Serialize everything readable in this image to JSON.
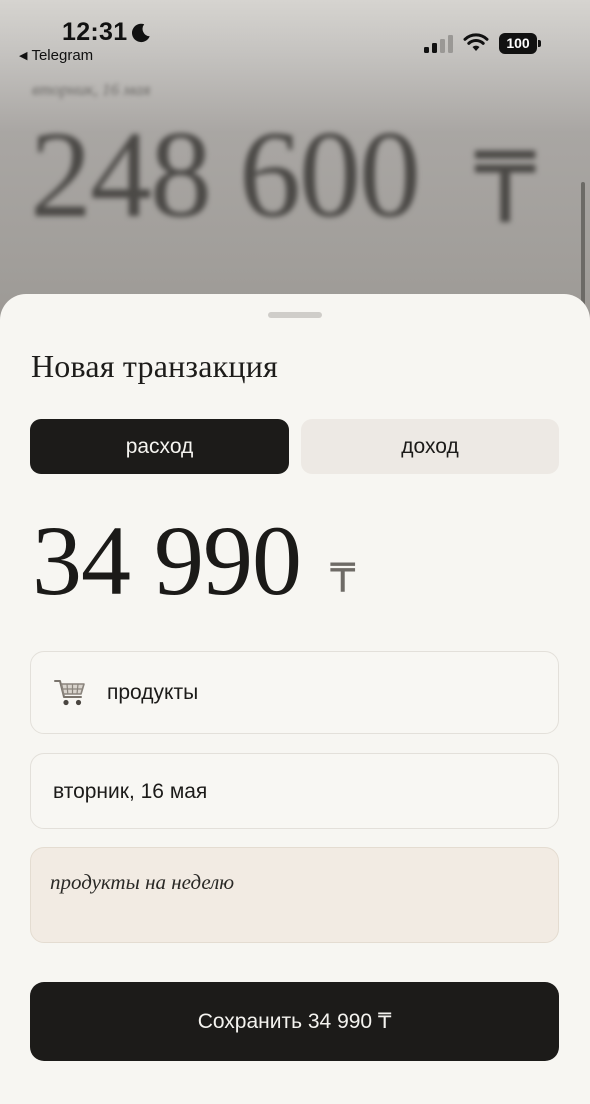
{
  "status_bar": {
    "time": "12:31",
    "back_app": "Telegram",
    "battery": "100",
    "icons": [
      "moon-icon",
      "signal-icon",
      "wifi-icon",
      "battery-icon"
    ]
  },
  "background": {
    "date": "вторник, 16 мая",
    "amount": "248 600",
    "currency": "₸"
  },
  "sheet": {
    "title": "Новая транзакция",
    "tabs": {
      "expense": "расход",
      "income": "доход",
      "active": "expense"
    },
    "amount": "34 990",
    "currency": "₸",
    "category": {
      "icon": "shopping-cart-icon",
      "label": "продукты"
    },
    "date": "вторник, 16 мая",
    "note": "продукты на неделю",
    "save_label": "Сохранить 34 990 ₸"
  },
  "colors": {
    "sheet_bg": "#f7f6f2",
    "dark": "#1c1b19",
    "segment_inactive": "#ede9e4",
    "note_bg": "#f2ebe3"
  }
}
